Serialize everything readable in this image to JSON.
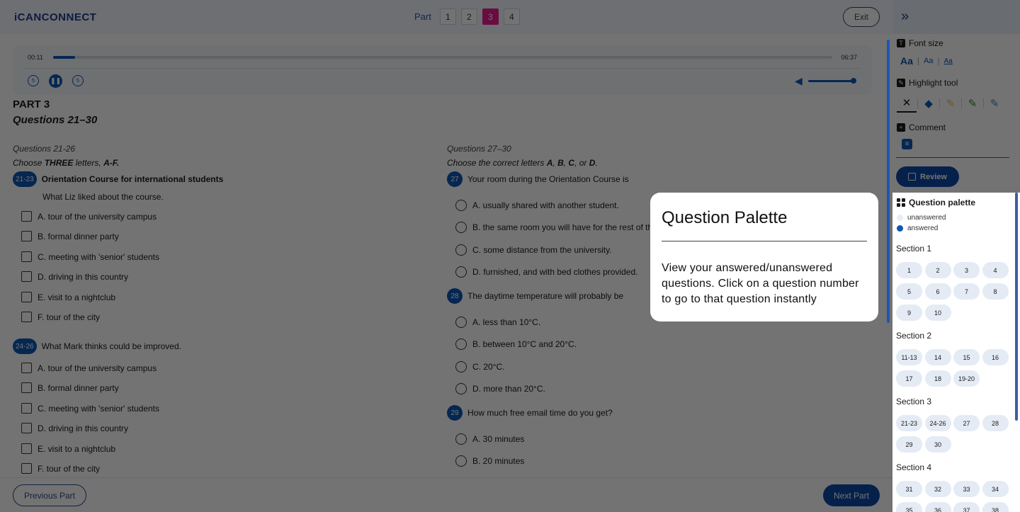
{
  "app": {
    "logo": "iCANCONNECT"
  },
  "topbar": {
    "part_label": "Part",
    "parts": [
      "1",
      "2",
      "3",
      "4"
    ],
    "active_part": "3",
    "exit_label": "Exit"
  },
  "player": {
    "time_current": "00:11",
    "time_total": "06:37",
    "progress": 0.028,
    "volume": 1.0,
    "icons": [
      "rewind-5-icon",
      "pause-icon",
      "forward-5-icon",
      "volume-icon"
    ]
  },
  "part": {
    "title": "PART 3",
    "range": "Questions 21–30"
  },
  "left": {
    "section_label": "Questions 21-26",
    "instruction_pre": "Choose ",
    "instruction_bold": "THREE",
    "instruction_mid": " letters, ",
    "instruction_letters": "A-F.",
    "groups": [
      {
        "num": "21-23",
        "title": "Orientation Course for international students",
        "subtitle": "What Liz liked about the course.",
        "options": [
          "A. tour of the university campus",
          "B. formal dinner party",
          "C. meeting with 'senior' students",
          "D. driving in this country",
          "E. visit to a nightclub",
          "F. tour of the city"
        ]
      },
      {
        "num": "24-26",
        "title": "What Mark thinks could be improved.",
        "options": [
          "A. tour of the university campus",
          "B. formal dinner party",
          "C. meeting with 'senior' students",
          "D. driving in this country",
          "E. visit to a nightclub",
          "F. tour of the city"
        ]
      }
    ]
  },
  "right": {
    "section_label": "Questions 27–30",
    "instruction_pre": "Choose the correct letters ",
    "instruction_letters_a": "A",
    "instruction_letters_b": "B",
    "instruction_letters_c": "C",
    "instruction_or": ", or ",
    "instruction_letters_d": "D",
    "questions": [
      {
        "num": "27",
        "text": "Your room during the Orientation Course is",
        "options": [
          "A. usually shared with another student.",
          "B. the same room you will have for the rest of th",
          "C. some distance from the university.",
          "D. furnished, and with bed clothes provided."
        ]
      },
      {
        "num": "28",
        "text": "The daytime temperature will probably be",
        "options": [
          "A. less than 10°C.",
          "B. between 10°C and 20°C.",
          "C. 20°C.",
          "D. more than 20°C."
        ]
      },
      {
        "num": "29",
        "text": "How much free email time do you get?",
        "options": [
          "A. 30 minutes",
          "B. 20 minutes"
        ]
      }
    ]
  },
  "bottombar": {
    "prev_label": "Previous Part",
    "next_label": "Next Part"
  },
  "sidebar": {
    "font_size_title": "Font size",
    "font_sizes": [
      "Aa",
      "Aa",
      "Aa"
    ],
    "highlight_title": "Highlight tool",
    "highlight_tools": [
      "no-highlight-icon",
      "eraser-icon",
      "yellow-marker-icon",
      "green-marker-icon",
      "blue-marker-icon"
    ],
    "comment_title": "Comment",
    "review_label": "Review",
    "palette_title": "Question palette",
    "legend_unanswered": "unanswered",
    "legend_answered": "answered",
    "sections": [
      {
        "title": "Section 1",
        "items": [
          "1",
          "2",
          "3",
          "4",
          "5",
          "6",
          "7",
          "8",
          "9",
          "10"
        ]
      },
      {
        "title": "Section 2",
        "items": [
          "11-13",
          "14",
          "15",
          "16",
          "17",
          "18",
          "19-20"
        ]
      },
      {
        "title": "Section 3",
        "items": [
          "21-23",
          "24-26",
          "27",
          "28",
          "29",
          "30"
        ]
      },
      {
        "title": "Section 4",
        "items": [
          "31",
          "32",
          "33",
          "34",
          "35",
          "36",
          "37",
          "38"
        ]
      }
    ]
  },
  "tooltip": {
    "title": "Question Palette",
    "body": "View your answered/unanswered questions. Click on a question number to go to that question instantly"
  },
  "colors": {
    "accent": "#0d57b6",
    "active_part": "#e61e8c",
    "chip": "#e4ebf5",
    "overlay": "rgba(0,0,0,0.55)"
  }
}
